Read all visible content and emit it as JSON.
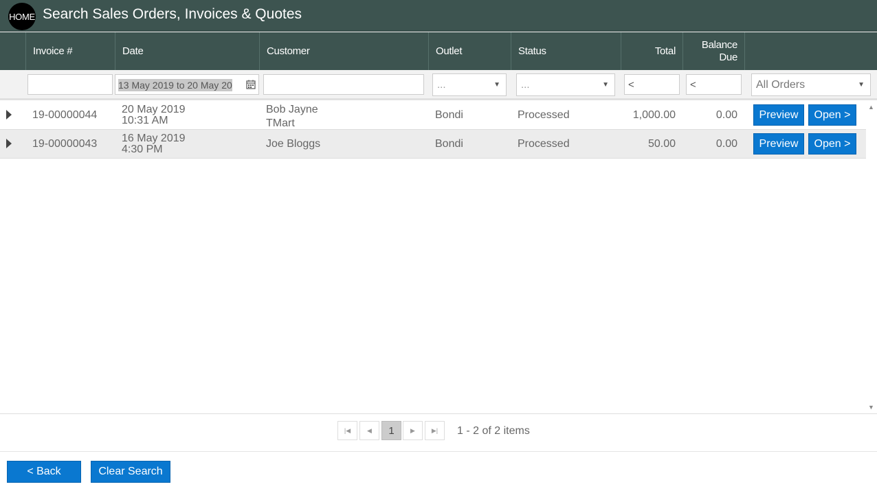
{
  "header": {
    "home_label": "HOME",
    "title": "Search Sales Orders, Invoices & Quotes"
  },
  "columns": {
    "invoice": "Invoice #",
    "date": "Date",
    "customer": "Customer",
    "outlet": "Outlet",
    "status": "Status",
    "total": "Total",
    "balance_line1": "Balance",
    "balance_line2": "Due"
  },
  "filters": {
    "invoice_value": "",
    "date_range": "13 May 2019 to 20 May 20",
    "customer_value": "",
    "outlet_selected": "...",
    "status_selected": "...",
    "total_value": "<",
    "balance_value": "<",
    "order_type_selected": "All Orders"
  },
  "rows": [
    {
      "invoice": "19-00000044",
      "date": "20 May 2019",
      "time": "10:31 AM",
      "customer": "Bob Jayne",
      "customer_line2": "TMart",
      "outlet": "Bondi",
      "status": "Processed",
      "total": "1,000.00",
      "balance": "0.00",
      "preview_label": "Preview",
      "open_label": "Open >"
    },
    {
      "invoice": "19-00000043",
      "date": "16 May 2019",
      "time": "4:30 PM",
      "customer": "Joe Bloggs",
      "customer_line2": "",
      "outlet": "Bondi",
      "status": "Processed",
      "total": "50.00",
      "balance": "0.00",
      "preview_label": "Preview",
      "open_label": "Open >"
    }
  ],
  "pager": {
    "current_page": "1",
    "info": "1 - 2 of 2 items",
    "first_icon": "first-page-icon",
    "prev_icon": "prev-page-icon",
    "next_icon": "next-page-icon",
    "last_icon": "last-page-icon"
  },
  "footer": {
    "back_label": "< Back",
    "clear_label": "Clear Search"
  },
  "colors": {
    "header_bg": "#3d5450",
    "accent_blue": "#0a78d0",
    "alt_row": "#ececec"
  }
}
